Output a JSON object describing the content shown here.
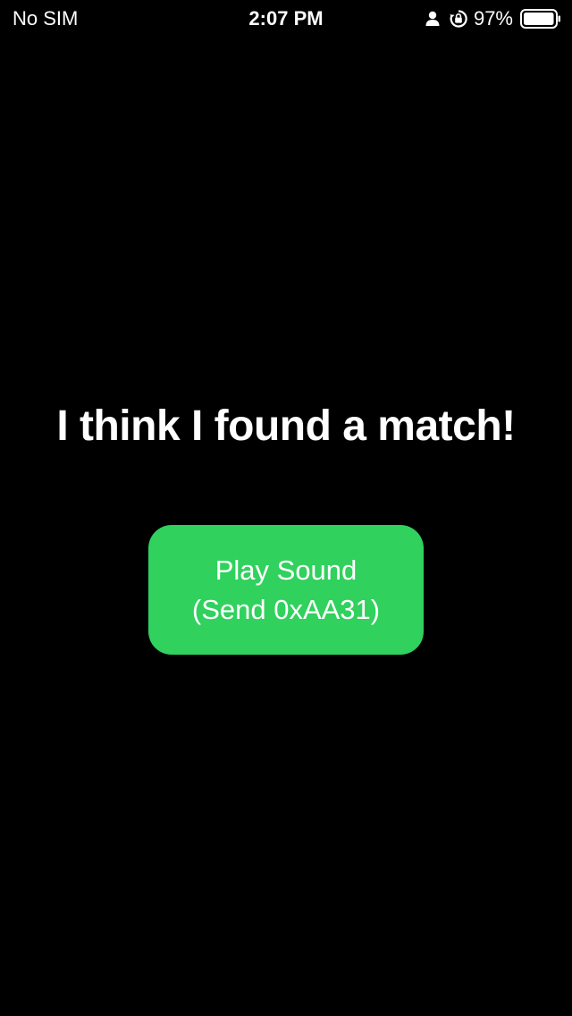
{
  "status_bar": {
    "carrier": "No SIM",
    "time": "2:07 PM",
    "battery_percent": "97%",
    "icons": [
      "person-icon",
      "lock-rotation-icon",
      "battery-icon"
    ]
  },
  "main": {
    "message": "I think I found a match!",
    "play_button": {
      "line1": "Play Sound",
      "line2": "(Send 0xAA31)",
      "color": "#30d15d"
    }
  },
  "colors": {
    "background": "#000000",
    "text": "#ffffff",
    "accent": "#30d15d"
  }
}
